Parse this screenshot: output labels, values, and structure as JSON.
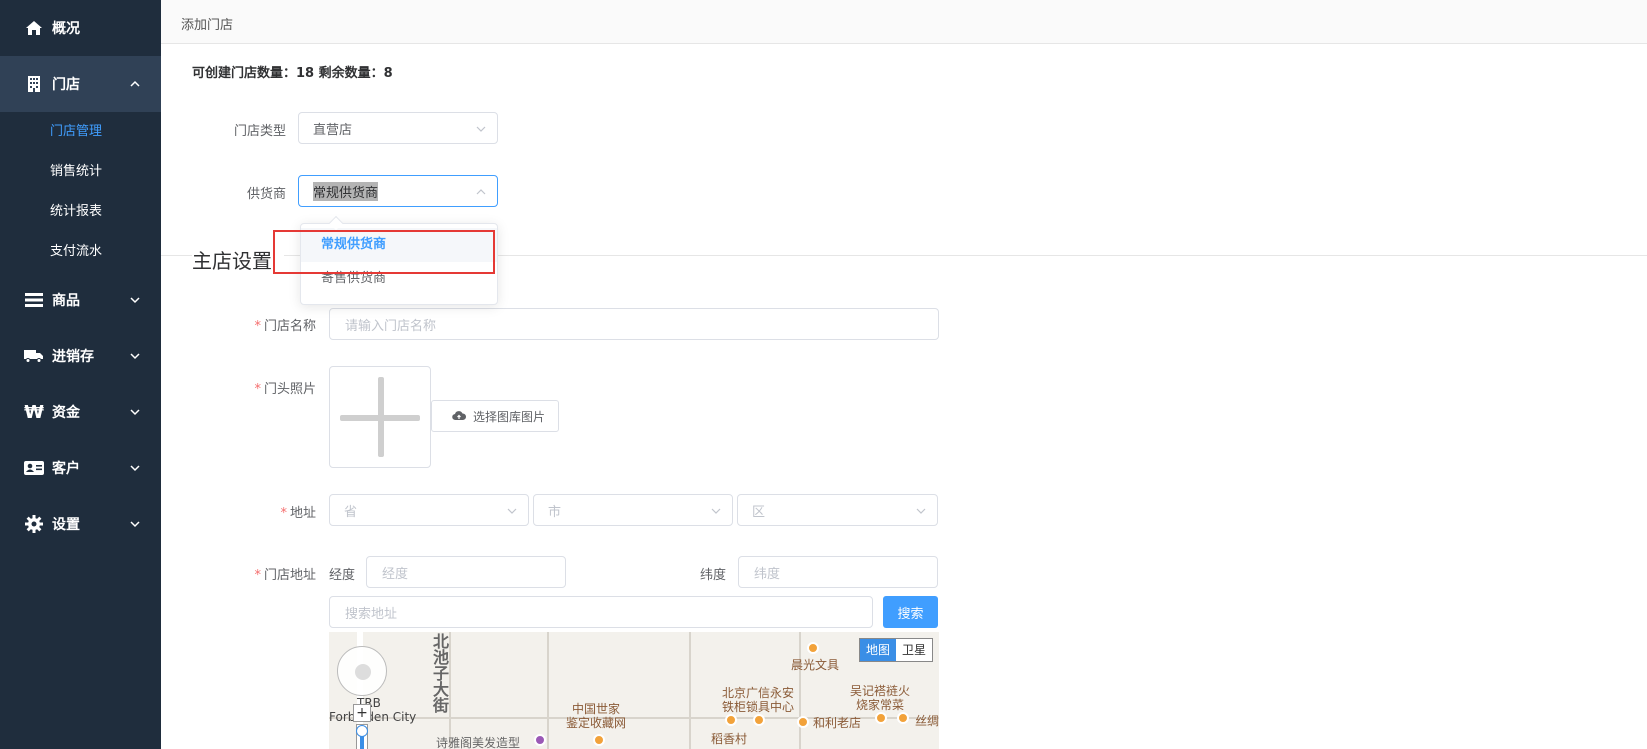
{
  "sidebar": {
    "items": [
      {
        "label": "概况",
        "icon": "home-icon"
      },
      {
        "label": "门店",
        "icon": "building-icon",
        "expanded": true,
        "children": [
          "门店管理",
          "销售统计",
          "统计报表",
          "支付流水"
        ],
        "active_child": "门店管理"
      },
      {
        "label": "商品",
        "icon": "list-icon"
      },
      {
        "label": "进销存",
        "icon": "truck-icon"
      },
      {
        "label": "资金",
        "icon": "won-icon"
      },
      {
        "label": "客户",
        "icon": "id-card-icon"
      },
      {
        "label": "设置",
        "icon": "gear-icon"
      }
    ]
  },
  "breadcrumb": "添加门店",
  "quota": {
    "text": "可创建门店数量：18 剩余数量：8"
  },
  "form": {
    "store_type": {
      "label": "门店类型",
      "value": "直营店"
    },
    "supplier": {
      "label": "供货商",
      "value": "常规供货商",
      "options": [
        "常规供货商",
        "寄售供货商"
      ],
      "selected": "常规供货商"
    },
    "section_title": "主店设置",
    "store_name": {
      "label": "门店名称",
      "placeholder": "请输入门店名称"
    },
    "store_photo": {
      "label": "门头照片",
      "library_button": "选择图库图片"
    },
    "address": {
      "label": "地址",
      "province": "省",
      "city": "市",
      "district": "区"
    },
    "store_address": {
      "label": "门店地址",
      "longitude_label": "经度",
      "longitude_placeholder": "经度",
      "latitude_label": "纬度",
      "latitude_placeholder": "纬度",
      "search_placeholder": "搜索地址",
      "search_button": "搜索"
    }
  },
  "map": {
    "toggle": {
      "map": "地图",
      "satellite": "卫星",
      "active": "地图"
    },
    "labels": {
      "street": "北池子大街",
      "trb": "TRB",
      "forbidden": "Forbidden City",
      "chenguang": "晨光文具",
      "wuji1": "吴记褡裢火",
      "wuji2": "烧家常菜",
      "zhongguo1": "中国世家",
      "zhongguo2": "鉴定收藏网",
      "guangxin1": "北京广信永安",
      "guangxin2": "铁柜锁具中心",
      "heli": "和利老店",
      "sizhou": "丝绸",
      "shiya": "诗雅阁美发造型",
      "daoxiang": "稻香村"
    },
    "colors": {
      "poi": "#f2a23a",
      "active_toggle": "#3a8ee6"
    }
  },
  "colors": {
    "sidebar": "#1f2d3d",
    "accent": "#409eff",
    "required": "#f56c6c",
    "highlight_box": "#e53935"
  }
}
